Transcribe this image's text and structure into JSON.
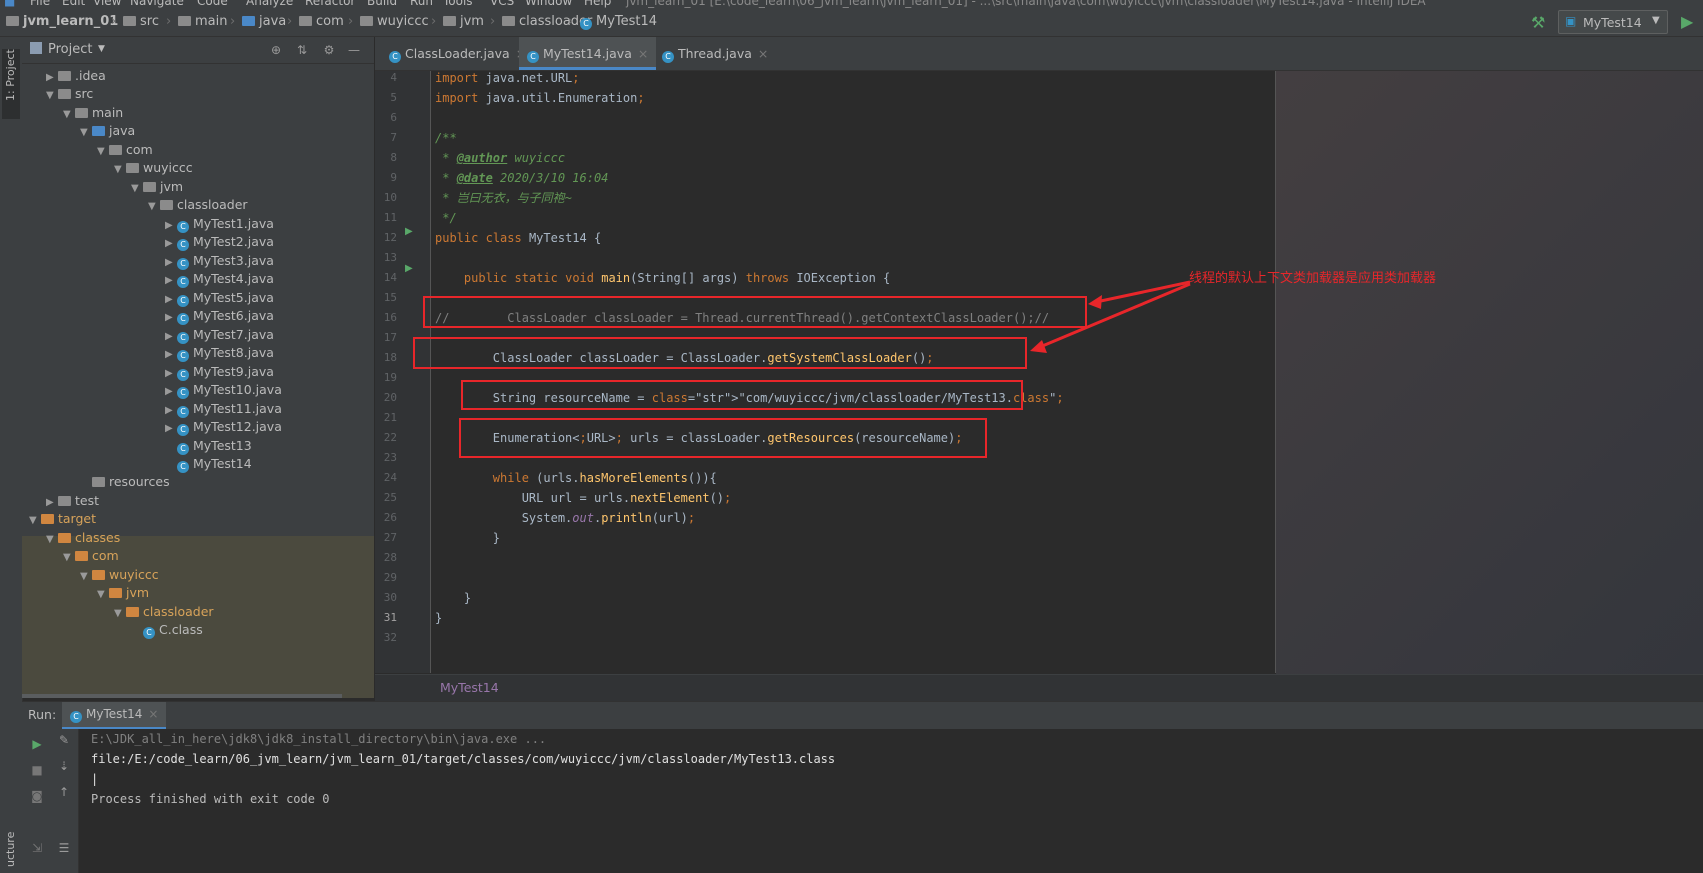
{
  "menu": [
    "File",
    "Edit",
    "View",
    "Navigate",
    "Code",
    "Analyze",
    "Refactor",
    "Build",
    "Run",
    "Tools",
    "VCS",
    "Window",
    "Help"
  ],
  "window_title": "jvm_learn_01 [E:\\code_learn\\06_jvm_learn\\jvm_learn_01] - ...\\src\\main\\java\\com\\wuyiccc\\jvm\\classloader\\MyTest14.java - IntelliJ IDEA",
  "breadcrumbs": [
    "jvm_learn_01",
    "src",
    "main",
    "java",
    "com",
    "wuyiccc",
    "jvm",
    "classloader",
    "MyTest14"
  ],
  "run_config": "MyTest14",
  "left_stripe_label": "1: Project",
  "left_stripe_bottom_label": "ucture",
  "project_pane": {
    "title": "Project",
    "tree": [
      {
        "label": ".idea",
        "icon": "folder-gray"
      },
      {
        "label": "src",
        "icon": "folder-gray"
      },
      {
        "label": "main",
        "icon": "folder-gray"
      },
      {
        "label": "java",
        "icon": "folder-blue"
      },
      {
        "label": "com",
        "icon": "folder-gray"
      },
      {
        "label": "wuyiccc",
        "icon": "folder-gray"
      },
      {
        "label": "jvm",
        "icon": "folder-gray"
      },
      {
        "label": "classloader",
        "icon": "folder-gray"
      },
      {
        "label": "MyTest1.java",
        "icon": "class-icon"
      },
      {
        "label": "MyTest2.java",
        "icon": "class-icon"
      },
      {
        "label": "MyTest3.java",
        "icon": "class-icon"
      },
      {
        "label": "MyTest4.java",
        "icon": "class-icon"
      },
      {
        "label": "MyTest5.java",
        "icon": "class-icon"
      },
      {
        "label": "MyTest6.java",
        "icon": "class-icon"
      },
      {
        "label": "MyTest7.java",
        "icon": "class-icon"
      },
      {
        "label": "MyTest8.java",
        "icon": "class-icon"
      },
      {
        "label": "MyTest9.java",
        "icon": "class-icon"
      },
      {
        "label": "MyTest10.java",
        "icon": "class-icon"
      },
      {
        "label": "MyTest11.java",
        "icon": "class-icon"
      },
      {
        "label": "MyTest12.java",
        "icon": "class-icon"
      },
      {
        "label": "MyTest13",
        "icon": "class-icon"
      },
      {
        "label": "MyTest14",
        "icon": "class-icon"
      },
      {
        "label": "resources",
        "icon": "folder-gray"
      },
      {
        "label": "test",
        "icon": "folder-gray"
      },
      {
        "label": "target",
        "icon": "folder-orange"
      },
      {
        "label": "classes",
        "icon": "folder-orange"
      },
      {
        "label": "com",
        "icon": "folder-orange"
      },
      {
        "label": "wuyiccc",
        "icon": "folder-orange"
      },
      {
        "label": "jvm",
        "icon": "folder-orange"
      },
      {
        "label": "classloader",
        "icon": "folder-orange"
      },
      {
        "label": "C.class",
        "icon": "class-icon"
      }
    ]
  },
  "editor": {
    "tabs": [
      {
        "label": "ClassLoader.java",
        "active": false
      },
      {
        "label": "MyTest14.java",
        "active": true
      },
      {
        "label": "Thread.java",
        "active": false
      }
    ],
    "line_numbers": [
      "4",
      "5",
      "6",
      "7",
      "8",
      "9",
      "10",
      "11",
      "12",
      "13",
      "14",
      "15",
      "16",
      "17",
      "18",
      "19",
      "20",
      "21",
      "22",
      "23",
      "24",
      "25",
      "26",
      "27",
      "28",
      "29",
      "30",
      "31",
      "32"
    ],
    "lines": [
      "import java.net.URL;",
      "import java.util.Enumeration;",
      "",
      "/**",
      " * @author wuyiccc",
      " * @date 2020/3/10 16:04",
      " * 岂曰无衣，与子同袍~",
      " */",
      "public class MyTest14 {",
      "",
      "    public static void main(String[] args) throws IOException {",
      "",
      "//        ClassLoader classLoader = Thread.currentThread().getContextClassLoader();//",
      "",
      "        ClassLoader classLoader = ClassLoader.getSystemClassLoader();",
      "",
      "        String resourceName = \"com/wuyiccc/jvm/classloader/MyTest13.class\";",
      "",
      "        Enumeration<URL> urls = classLoader.getResources(resourceName);",
      "",
      "        while (urls.hasMoreElements()){",
      "            URL url = urls.nextElement();",
      "            System.out.println(url);",
      "        }",
      "",
      "",
      "    }",
      "}",
      ""
    ],
    "annotation": "线程的默认上下文类加载器是应用类加载器",
    "bottom_breadcrumb": "MyTest14"
  },
  "run_panel": {
    "label": "Run:",
    "tab": "MyTest14",
    "console": [
      "E:\\JDK_all_in_here\\jdk8\\jdk8_install_directory\\bin\\java.exe ...",
      "file:/E:/code_learn/06_jvm_learn/jvm_learn_01/target/classes/com/wuyiccc/jvm/classloader/MyTest13.class",
      "|",
      "Process finished with exit code 0"
    ]
  },
  "colors": {
    "accent": "#4a88c7",
    "highlight_box": "#e8262a"
  }
}
